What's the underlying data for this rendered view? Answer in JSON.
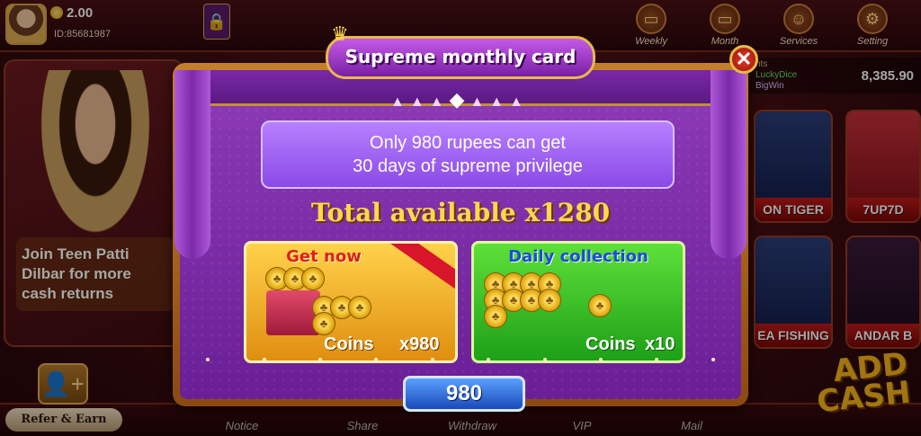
{
  "header": {
    "balance": "2.00",
    "user_id": "ID:85681987",
    "icons": [
      {
        "label": "Weekly",
        "icon": "weekly-card-icon"
      },
      {
        "label": "Month",
        "icon": "month-card-icon"
      },
      {
        "label": "Services",
        "icon": "headset-icon"
      },
      {
        "label": "Setting",
        "icon": "gear-icon"
      }
    ]
  },
  "winner_feed": {
    "line1": "nts",
    "line2": "LuckyDice",
    "line3": "BigWin",
    "amount": "8,385.90"
  },
  "promo": {
    "text": "Join Teen Patti Dilbar for more cash returns"
  },
  "games": [
    {
      "label": "ON TIGER"
    },
    {
      "label": "7UP7D"
    },
    {
      "label": "EA FISHING"
    },
    {
      "label": "ANDAR B"
    }
  ],
  "bottom_nav": [
    "Notice",
    "Share",
    "Withdraw",
    "VIP",
    "Mail"
  ],
  "refer": {
    "label": "Refer & Earn"
  },
  "add_cash": {
    "line1": "ADD",
    "line2": "CASH"
  },
  "modal": {
    "title": "Supreme monthly card",
    "info_line1": "Only 980 rupees can get",
    "info_line2": "30 days of supreme privilege",
    "total_label": "Total available x1280",
    "get_now": {
      "title": "Get now",
      "coins_label": "Coins",
      "coins_value": "x980"
    },
    "daily": {
      "title": "Daily collection",
      "coins_label": "Coins",
      "coins_value": "x10"
    },
    "price": "980"
  },
  "colors": {
    "modal_purple": "#8e3bb8",
    "gold_accent": "#e7b94a",
    "get_now_card": "#ffd24a",
    "daily_card": "#5ee03a",
    "price_button": "#1a4ab8"
  }
}
